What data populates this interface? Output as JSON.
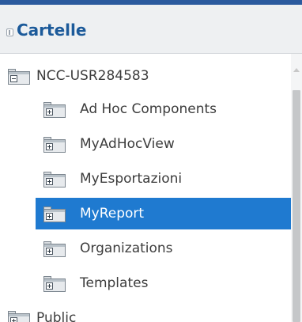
{
  "header": {
    "title": "Cartelle",
    "collapse_icon": "collapse-panel-icon"
  },
  "tree": {
    "root": {
      "label": "NCC-USR284583",
      "icon": "folder-minus-icon",
      "expanded": true
    },
    "children": [
      {
        "label": "Ad Hoc Components",
        "icon": "folder-plus-icon",
        "selected": false
      },
      {
        "label": "MyAdHocView",
        "icon": "folder-plus-icon",
        "selected": false
      },
      {
        "label": "MyEsportazioni",
        "icon": "folder-plus-icon",
        "selected": false
      },
      {
        "label": "MyReport",
        "icon": "folder-plus-icon",
        "selected": true
      },
      {
        "label": "Organizations",
        "icon": "folder-plus-icon",
        "selected": false
      },
      {
        "label": "Templates",
        "icon": "folder-plus-icon",
        "selected": false
      }
    ],
    "sibling": {
      "label": "Public",
      "icon": "folder-plus-icon"
    }
  },
  "colors": {
    "accent": "#1f7ad0",
    "header_title": "#1c5a9a",
    "top_bar": "#2b5a9e"
  }
}
